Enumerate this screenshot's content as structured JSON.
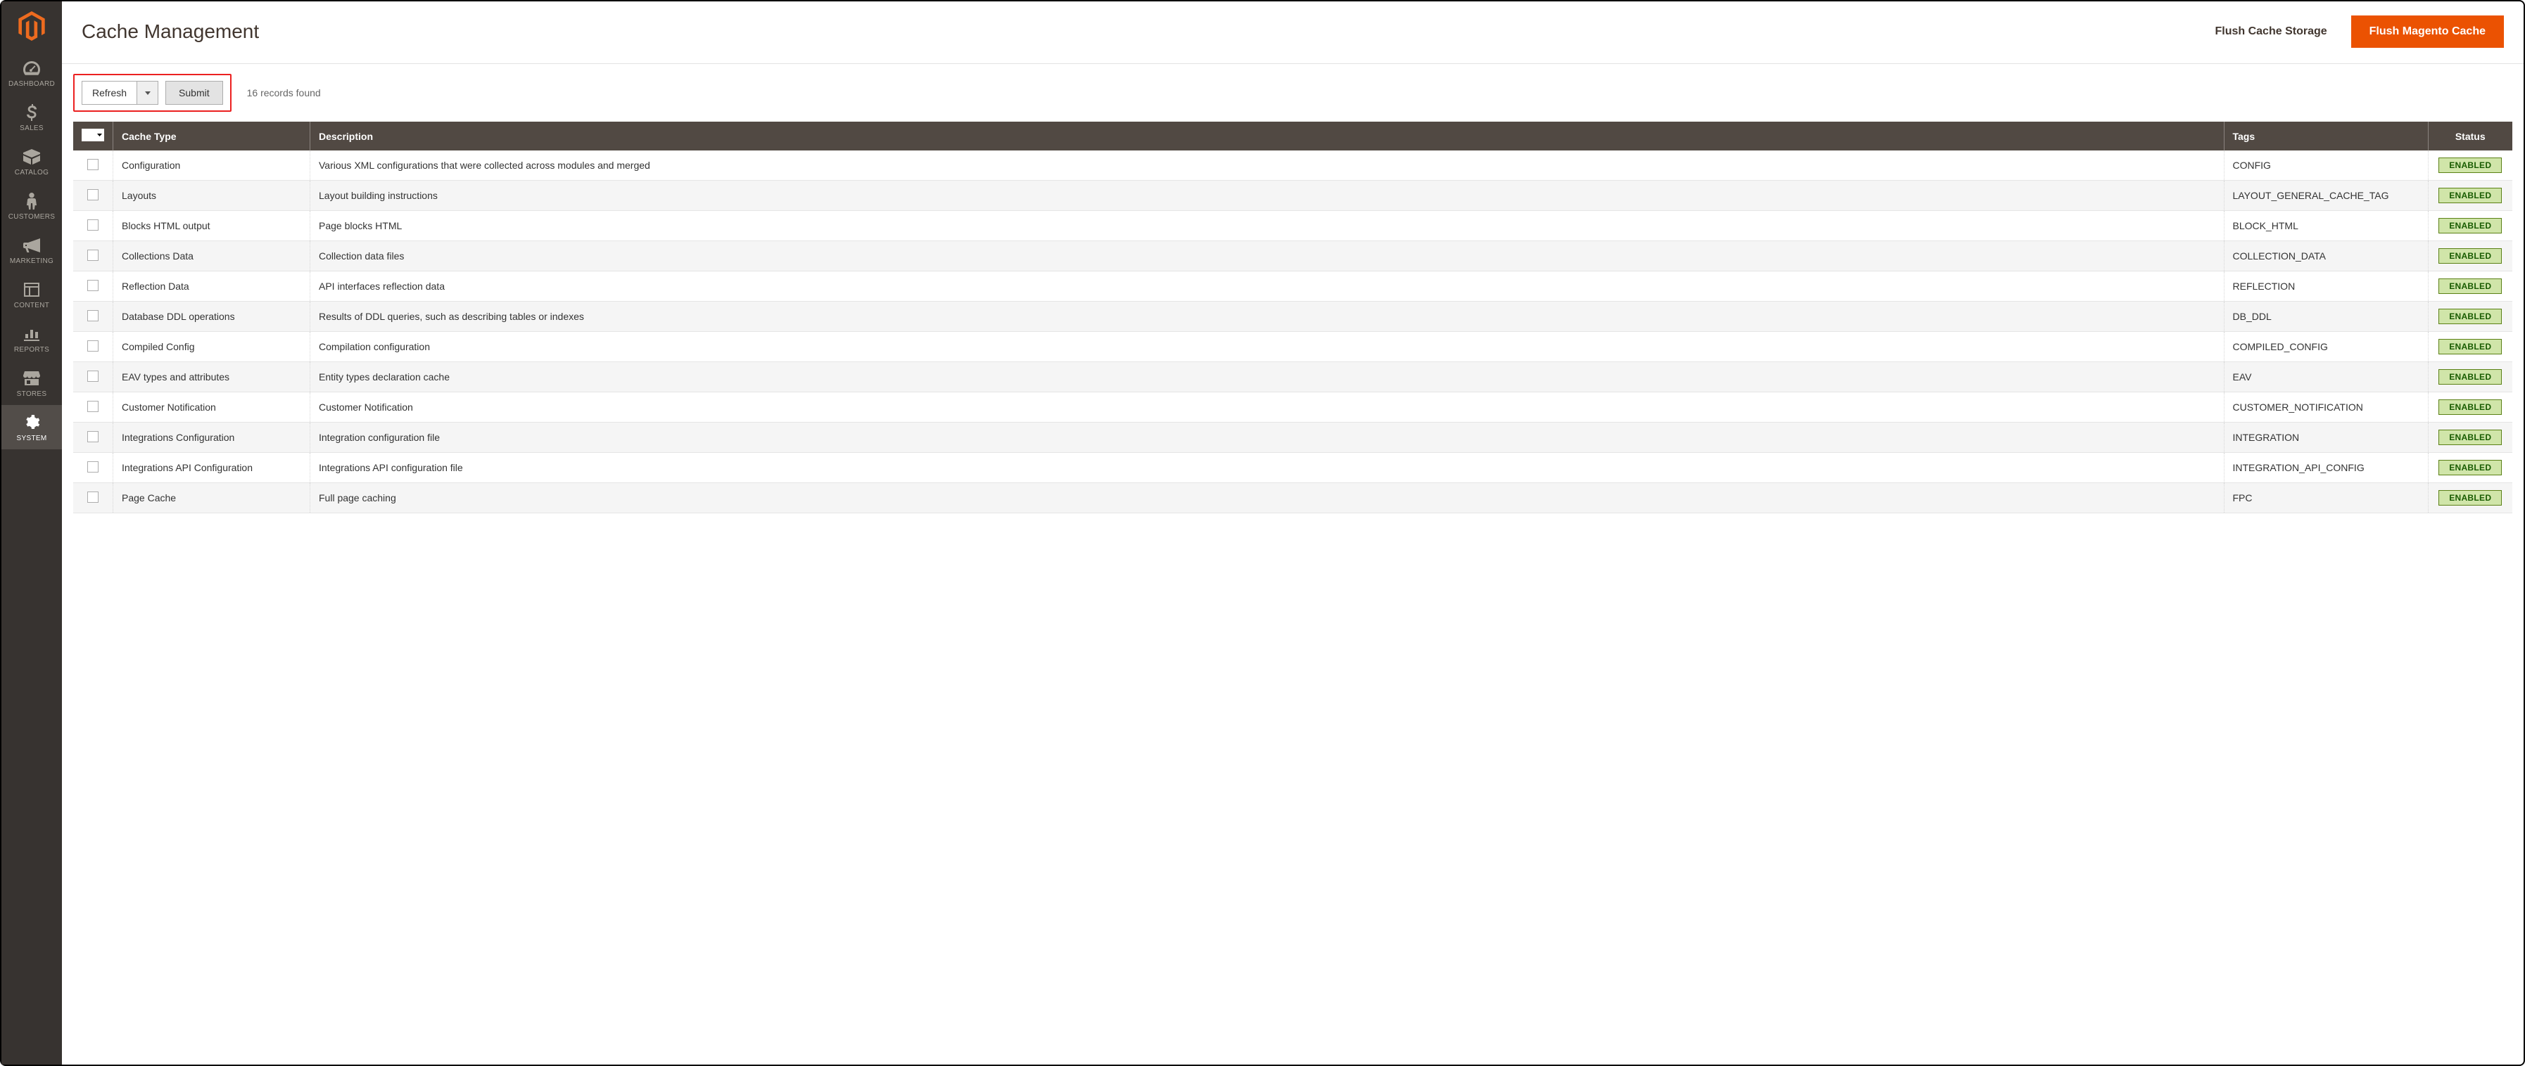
{
  "sidebar": {
    "items": [
      {
        "label": "DASHBOARD",
        "name": "dashboard"
      },
      {
        "label": "SALES",
        "name": "sales"
      },
      {
        "label": "CATALOG",
        "name": "catalog"
      },
      {
        "label": "CUSTOMERS",
        "name": "customers"
      },
      {
        "label": "MARKETING",
        "name": "marketing"
      },
      {
        "label": "CONTENT",
        "name": "content"
      },
      {
        "label": "REPORTS",
        "name": "reports"
      },
      {
        "label": "STORES",
        "name": "stores"
      },
      {
        "label": "SYSTEM",
        "name": "system"
      }
    ]
  },
  "header": {
    "title": "Cache Management",
    "flush_storage_label": "Flush Cache Storage",
    "flush_magento_label": "Flush Magento Cache"
  },
  "toolbar": {
    "action_select": "Refresh",
    "submit_label": "Submit",
    "records_found": "16 records found"
  },
  "table": {
    "headers": {
      "cache_type": "Cache Type",
      "description": "Description",
      "tags": "Tags",
      "status": "Status"
    },
    "rows": [
      {
        "type": "Configuration",
        "desc": "Various XML configurations that were collected across modules and merged",
        "tag": "CONFIG",
        "status": "ENABLED"
      },
      {
        "type": "Layouts",
        "desc": "Layout building instructions",
        "tag": "LAYOUT_GENERAL_CACHE_TAG",
        "status": "ENABLED"
      },
      {
        "type": "Blocks HTML output",
        "desc": "Page blocks HTML",
        "tag": "BLOCK_HTML",
        "status": "ENABLED"
      },
      {
        "type": "Collections Data",
        "desc": "Collection data files",
        "tag": "COLLECTION_DATA",
        "status": "ENABLED"
      },
      {
        "type": "Reflection Data",
        "desc": "API interfaces reflection data",
        "tag": "REFLECTION",
        "status": "ENABLED"
      },
      {
        "type": "Database DDL operations",
        "desc": "Results of DDL queries, such as describing tables or indexes",
        "tag": "DB_DDL",
        "status": "ENABLED"
      },
      {
        "type": "Compiled Config",
        "desc": "Compilation configuration",
        "tag": "COMPILED_CONFIG",
        "status": "ENABLED"
      },
      {
        "type": "EAV types and attributes",
        "desc": "Entity types declaration cache",
        "tag": "EAV",
        "status": "ENABLED"
      },
      {
        "type": "Customer Notification",
        "desc": "Customer Notification",
        "tag": "CUSTOMER_NOTIFICATION",
        "status": "ENABLED"
      },
      {
        "type": "Integrations Configuration",
        "desc": "Integration configuration file",
        "tag": "INTEGRATION",
        "status": "ENABLED"
      },
      {
        "type": "Integrations API Configuration",
        "desc": "Integrations API configuration file",
        "tag": "INTEGRATION_API_CONFIG",
        "status": "ENABLED"
      },
      {
        "type": "Page Cache",
        "desc": "Full page caching",
        "tag": "FPC",
        "status": "ENABLED"
      }
    ]
  }
}
